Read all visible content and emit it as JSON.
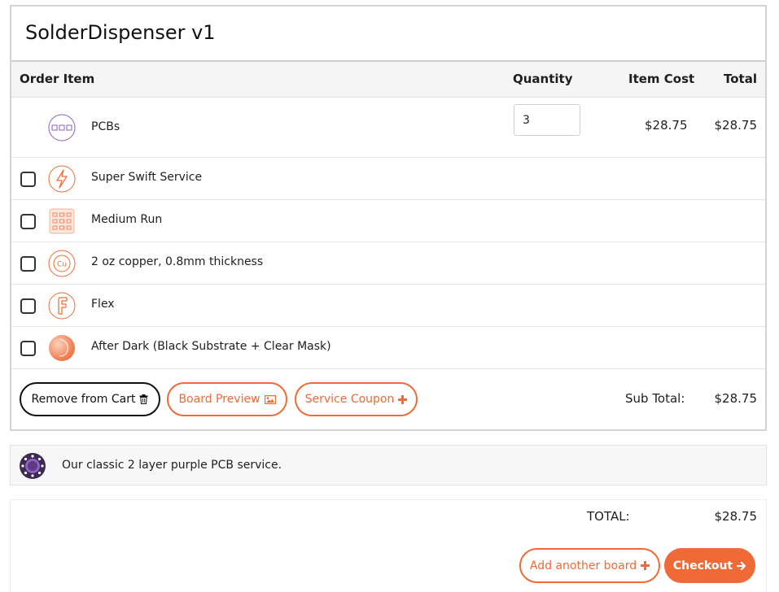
{
  "cart": {
    "title": "SolderDispenser v1",
    "columns": {
      "item": "Order Item",
      "quantity": "Quantity",
      "item_cost": "Item Cost",
      "total": "Total"
    },
    "main_item": {
      "icon": "pcb-icon",
      "label": "PCBs",
      "quantity": "3",
      "item_cost": "$28.75",
      "total": "$28.75"
    },
    "options": [
      {
        "icon": "lightning-icon",
        "label": "Super Swift Service",
        "checked": false
      },
      {
        "icon": "grid-icon",
        "label": "Medium Run",
        "checked": false
      },
      {
        "icon": "copper-icon",
        "label": "2 oz copper, 0.8mm thickness",
        "checked": false
      },
      {
        "icon": "flex-icon",
        "label": "Flex",
        "checked": false
      },
      {
        "icon": "after-dark-icon",
        "label": "After Dark (Black Substrate + Clear Mask)",
        "checked": false
      }
    ],
    "actions": {
      "remove_label": "Remove from Cart",
      "preview_label": "Board Preview",
      "coupon_label": "Service Coupon"
    },
    "subtotal": {
      "label": "Sub Total:",
      "value": "$28.75"
    }
  },
  "info": {
    "icon": "purple-gear-icon",
    "text": "Our classic 2 layer purple PCB service."
  },
  "summary": {
    "total_label": "TOTAL:",
    "total_value": "$28.75",
    "add_label": "Add another board",
    "checkout_label": "Checkout"
  },
  "colors": {
    "accent": "#ef6a36",
    "purple": "#8e5fc2",
    "border": "#d4d4d4"
  }
}
